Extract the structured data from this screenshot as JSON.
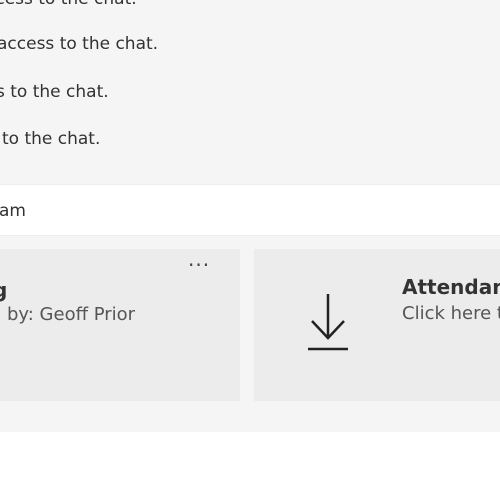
{
  "chat": {
    "lines": [
      "ccess to the chat.",
      "access to the chat.",
      "s to the chat.",
      "to the chat."
    ]
  },
  "input": {
    "text": "am"
  },
  "recording_card": {
    "title": "g",
    "subtitle": "by: Geoff Prior",
    "more_label": "···"
  },
  "attendance_card": {
    "title": "Attendan",
    "subtitle": "Click here t",
    "icon": "download-icon"
  },
  "colors": {
    "background": "#f5f5f5",
    "card": "#ececec",
    "input": "#ffffff",
    "text": "#323232"
  }
}
